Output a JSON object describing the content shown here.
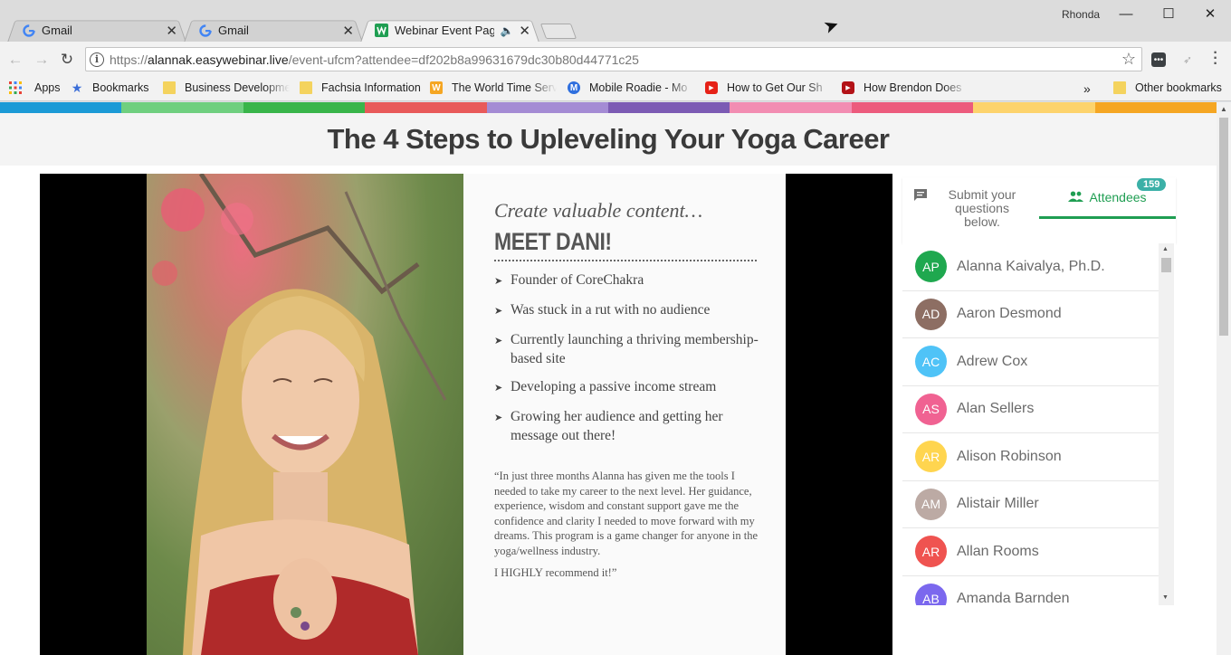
{
  "browser": {
    "tabs": [
      {
        "title": "Gmail",
        "icon": "google-g-icon"
      },
      {
        "title": "Gmail",
        "icon": "google-g-icon"
      },
      {
        "title": "Webinar Event Page",
        "icon": "easywebinar-icon"
      }
    ],
    "user": "Rhonda",
    "url": {
      "scheme": "https://",
      "host": "alannak.easywebinar.live",
      "path": "/event-ufcm?attendee=df202b8a99631679dc30b80d44771c25"
    },
    "bookmarks": [
      {
        "label": "Apps"
      },
      {
        "label": "Bookmarks"
      },
      {
        "label": "Business Developme"
      },
      {
        "label": "Fachsia Information"
      },
      {
        "label": "The World Time Serv"
      },
      {
        "label": "Mobile Roadie - Mo"
      },
      {
        "label": "How to Get Our Sh"
      },
      {
        "label": "How Brendon Does"
      }
    ],
    "overflow": "»",
    "other_bookmarks": "Other bookmarks"
  },
  "page": {
    "color_bar": [
      "#1b9ad6",
      "#6fcf7f",
      "#39b54a",
      "#e85a5a",
      "#a48bd4",
      "#7c5bb4",
      "#f28db2",
      "#ec5b7d",
      "#fdd36c",
      "#f5a623"
    ],
    "title": "The 4 Steps to Upleveling Your Yoga Career"
  },
  "slide": {
    "subtitle": "Create valuable content…",
    "heading": "MEET DANI!",
    "bullets": [
      "Founder of CoreChakra",
      "Was stuck in a rut with no audience",
      "Currently launching a thriving membership-based site",
      "Developing a passive income stream",
      "Growing her audience and getting her message out there!"
    ],
    "quote": "“In just three months Alanna has given me the tools I needed to take my career to the next level. Her guidance, experience, wisdom and constant support gave me the confidence and clarity I needed to move forward with my dreams. This program is a game changer for anyone in the yoga/wellness industry.",
    "recommend": "I HIGHLY recommend it!”"
  },
  "sidebar": {
    "questions_tab": "Submit your questions below.",
    "attendees_tab": "Attendees",
    "attendee_count": "159",
    "attendees": [
      {
        "initials": "AP",
        "name": "Alanna Kaivalya, Ph.D.",
        "color": "#1fa84f"
      },
      {
        "initials": "AD",
        "name": "Aaron Desmond",
        "color": "#8d6e63"
      },
      {
        "initials": "AC",
        "name": "Adrew Cox",
        "color": "#4fc3f7"
      },
      {
        "initials": "AS",
        "name": "Alan Sellers",
        "color": "#f06292"
      },
      {
        "initials": "AR",
        "name": "Alison Robinson",
        "color": "#ffd54f"
      },
      {
        "initials": "AM",
        "name": "Alistair Miller",
        "color": "#bcaaa4"
      },
      {
        "initials": "AR",
        "name": "Allan Rooms",
        "color": "#ef5350"
      },
      {
        "initials": "AB",
        "name": "Amanda Barnden",
        "color": "#7b68ee"
      }
    ]
  }
}
